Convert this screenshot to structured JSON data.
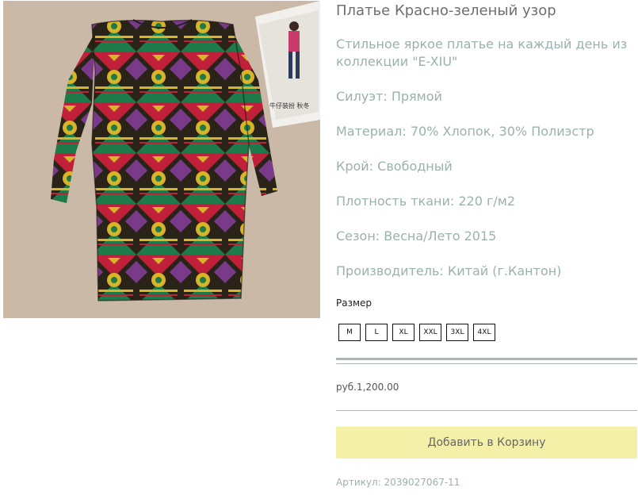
{
  "product": {
    "title": "Платье Красно-зеленый узор",
    "description": "Стильное яркое платье на каждый день из коллекции \"E-XIU\"",
    "attributes": [
      "Силуэт: Прямой",
      "Материал: 70% Хлопок, 30% Полиэстр",
      "Крой: Свободный",
      "Плотность ткани: 220 г/м2",
      "Сезон: Весна/Лето 2015",
      "Производитель: Китай (г.Кантон)"
    ],
    "size_label": "Размер",
    "sizes": [
      "M",
      "L",
      "XL",
      "XXL",
      "3XL",
      "4XL"
    ],
    "price": "руб.1,200.00",
    "add_to_cart": "Добавить в Корзину",
    "sku": "Артикул: 2039027067-11",
    "magazine_text": "牛仔装扮 秋冬"
  },
  "colors": {
    "muted_text": "#9bb1ad",
    "cart_button": "#f5f0a8",
    "divider": "#a8b8b5"
  }
}
